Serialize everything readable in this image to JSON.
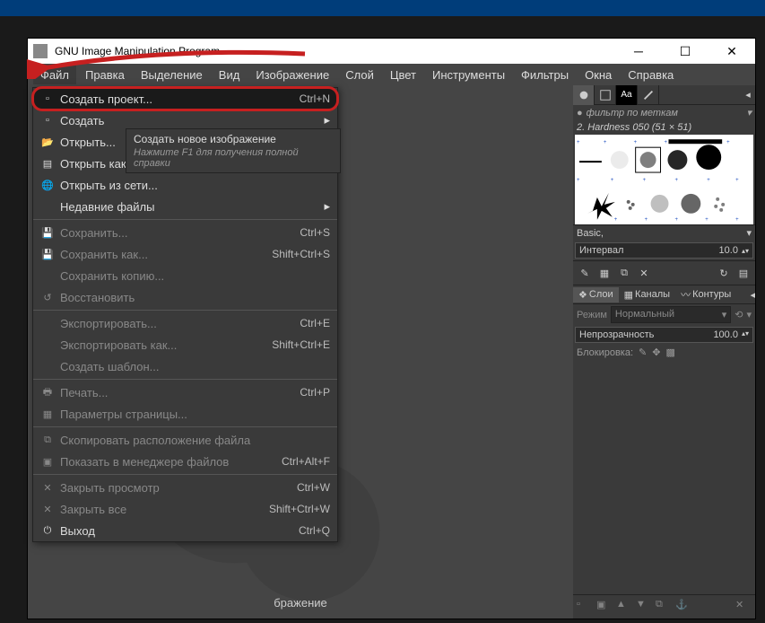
{
  "window": {
    "title": "GNU Image Manipulation Program",
    "canvas_hint": "бражение"
  },
  "menubar": [
    "Файл",
    "Правка",
    "Выделение",
    "Вид",
    "Изображение",
    "Слой",
    "Цвет",
    "Инструменты",
    "Фильтры",
    "Окна",
    "Справка"
  ],
  "file_menu": [
    {
      "label": "Создать проект...",
      "shortcut": "Ctrl+N",
      "highlighted": true,
      "icon": "doc"
    },
    {
      "label": "Создать",
      "submenu": true,
      "icon": "doc"
    },
    {
      "label": "Открыть...",
      "icon": "open"
    },
    {
      "label": "Открыть как слои...",
      "icon": "layers"
    },
    {
      "label": "Открыть из сети...",
      "icon": "globe"
    },
    {
      "label": "Недавние файлы",
      "submenu": true
    },
    {
      "sep": true
    },
    {
      "label": "Сохранить...",
      "shortcut": "Ctrl+S",
      "disabled": true,
      "icon": "save"
    },
    {
      "label": "Сохранить как...",
      "shortcut": "Shift+Ctrl+S",
      "disabled": true,
      "icon": "saveas"
    },
    {
      "label": "Сохранить копию...",
      "disabled": true
    },
    {
      "label": "Восстановить",
      "disabled": true,
      "icon": "revert"
    },
    {
      "sep": true
    },
    {
      "label": "Экспортировать...",
      "shortcut": "Ctrl+E",
      "disabled": true
    },
    {
      "label": "Экспортировать как...",
      "shortcut": "Shift+Ctrl+E",
      "disabled": true
    },
    {
      "label": "Создать шаблон...",
      "disabled": true
    },
    {
      "sep": true
    },
    {
      "label": "Печать...",
      "shortcut": "Ctrl+P",
      "disabled": true,
      "icon": "print"
    },
    {
      "label": "Параметры страницы...",
      "disabled": true,
      "icon": "page"
    },
    {
      "sep": true
    },
    {
      "label": "Скопировать расположение файла",
      "disabled": true,
      "icon": "copy"
    },
    {
      "label": "Показать в менеджере файлов",
      "shortcut": "Ctrl+Alt+F",
      "disabled": true,
      "icon": "folder"
    },
    {
      "sep": true
    },
    {
      "label": "Закрыть просмотр",
      "shortcut": "Ctrl+W",
      "disabled": true,
      "icon": "close"
    },
    {
      "label": "Закрыть все",
      "shortcut": "Shift+Ctrl+W",
      "disabled": true,
      "icon": "close"
    },
    {
      "label": "Выход",
      "shortcut": "Ctrl+Q",
      "icon": "quit"
    }
  ],
  "tooltip": {
    "title": "Создать новое изображение",
    "hint": "Нажмите F1 для получения полной справки"
  },
  "right_dock": {
    "filter_label": "фильтр по меткам",
    "brush_name": "2. Hardness 050 (51 × 51)",
    "basic_label": "Basic,",
    "interval_label": "Интервал",
    "interval_value": "10.0",
    "layer_tabs": [
      "Слои",
      "Каналы",
      "Контуры"
    ],
    "mode_label": "Режим",
    "mode_value": "Нормальный",
    "opacity_label": "Непрозрачность",
    "opacity_value": "100.0",
    "lock_label": "Блокировка:",
    "aa_label": "Aa"
  }
}
